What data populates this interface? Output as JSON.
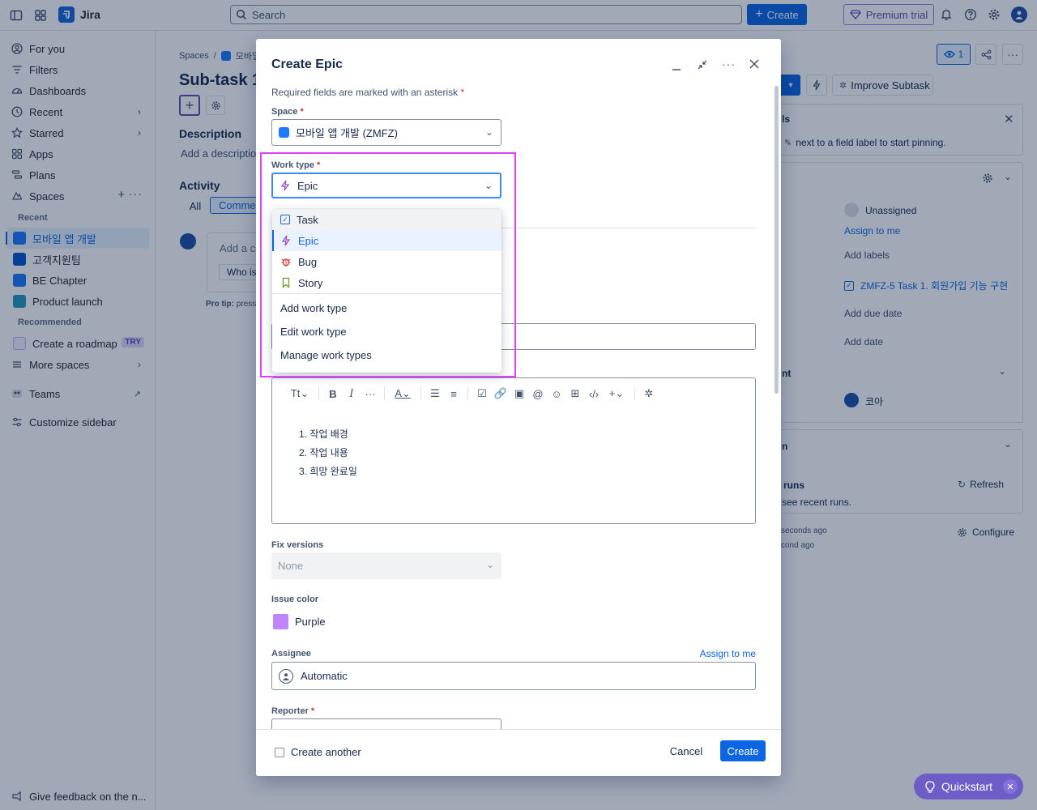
{
  "topbar": {
    "app_name": "Jira",
    "search_placeholder": "Search",
    "create_label": "Create",
    "premium_label": "Premium trial"
  },
  "sidebar": {
    "for_you": "For you",
    "filters": "Filters",
    "dashboards": "Dashboards",
    "recent": "Recent",
    "starred": "Starred",
    "apps": "Apps",
    "plans": "Plans",
    "spaces": "Spaces",
    "recent_heading": "Recent",
    "recent_spaces": [
      "모바일 앱 개발",
      "고객지원팀",
      "BE Chapter",
      "Product launch"
    ],
    "recommended_heading": "Recommended",
    "create_roadmap": "Create a roadmap",
    "try_badge": "TRY",
    "more_spaces": "More spaces",
    "teams": "Teams",
    "customize": "Customize sidebar",
    "feedback": "Give feedback on the n..."
  },
  "page": {
    "breadcrumb_spaces": "Spaces",
    "breadcrumb_sep": "/",
    "breadcrumb_space": "모바일",
    "title": "Sub-task 1",
    "description_heading": "Description",
    "description_placeholder": "Add a description...",
    "activity_heading": "Activity",
    "activity_tabs": [
      "All",
      "Comments"
    ],
    "comment_placeholder": "Add a co",
    "comment_suggestion": "Who is",
    "pro_tip": "Pro tip:",
    "pro_tip_rest": "press",
    "watch_count": "1",
    "improve_label": "Improve Subtask",
    "pinned_title": "ls",
    "pinned_hint": "next to a field label to start pinning.",
    "unassigned": "Unassigned",
    "assign_to_me": "Assign to me",
    "add_labels": "Add labels",
    "parent_link": "ZMFZ-5 Task 1. 회원가입 기능 구현",
    "add_due_date": "Add due date",
    "add_date": "Add date",
    "section_nt": "nt",
    "reporter_name": "코아",
    "section_n": "n",
    "runs_title": "runs",
    "runs_hint": "see recent runs.",
    "refresh": "Refresh",
    "time_1": "seconds ago",
    "time_2": "cond ago",
    "configure": "Configure"
  },
  "modal": {
    "title": "Create Epic",
    "required_note": "Required fields are marked with an asterisk",
    "asterisk": "*",
    "space_label": "Space",
    "space_value": "모바일 앱 개발 (ZMFZ)",
    "worktype_label": "Work type",
    "worktype_value": "Epic",
    "dropdown_types": [
      {
        "label": "Task",
        "icon": "task-icon",
        "color": "#1868db"
      },
      {
        "label": "Epic",
        "icon": "epic-icon",
        "color": "#964ac0"
      },
      {
        "label": "Bug",
        "icon": "bug-icon",
        "color": "#c9372c"
      },
      {
        "label": "Story",
        "icon": "story-icon",
        "color": "#6a9a23"
      }
    ],
    "dropdown_actions": [
      "Add work type",
      "Edit work type",
      "Manage work types"
    ],
    "editor_items": [
      "작업 배경",
      "작업 내용",
      "희망 완료일"
    ],
    "fix_versions_label": "Fix versions",
    "fix_versions_value": "None",
    "issue_color_label": "Issue color",
    "issue_color_value": "Purple",
    "issue_color_swatch": "#c084fc",
    "assignee_label": "Assignee",
    "assign_to_me": "Assign to me",
    "assignee_value": "Automatic",
    "reporter_label": "Reporter",
    "create_another": "Create another",
    "cancel": "Cancel",
    "create": "Create"
  },
  "quickstart": {
    "label": "Quickstart"
  },
  "colors": {
    "accent": "#0c66e4",
    "highlight": "#e040fb"
  }
}
